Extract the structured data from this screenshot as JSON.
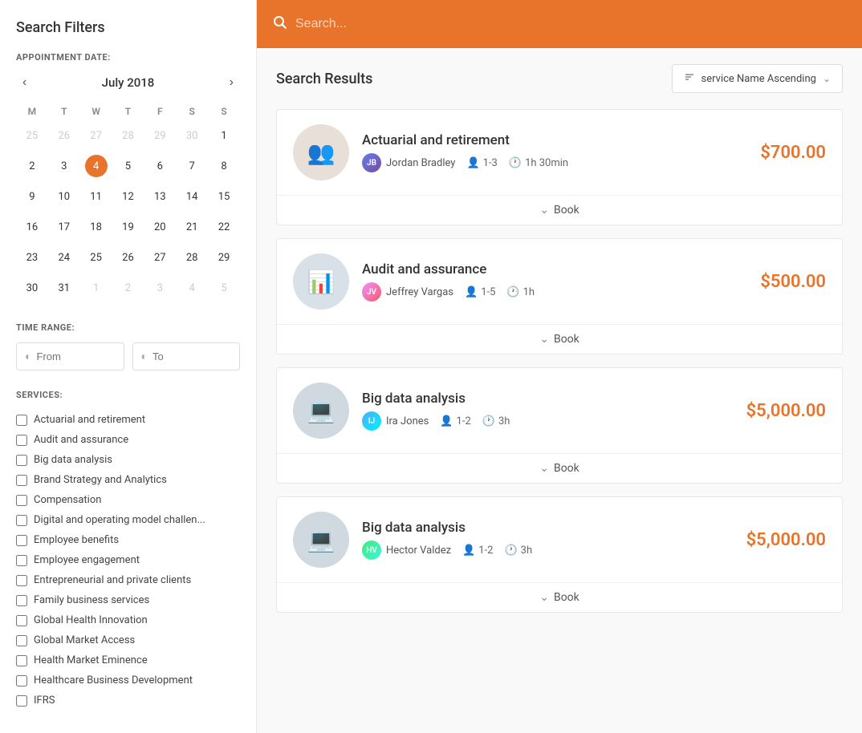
{
  "sidebar": {
    "title": "Search Filters",
    "appointment_date_label": "APPOINTMENT DATE:",
    "calendar": {
      "month_year": "July 2018",
      "days_of_week": [
        "M",
        "T",
        "W",
        "T",
        "F",
        "S",
        "S"
      ],
      "weeks": [
        [
          {
            "day": 25,
            "other": true
          },
          {
            "day": 26,
            "other": true
          },
          {
            "day": 27,
            "other": true
          },
          {
            "day": 28,
            "other": true
          },
          {
            "day": 29,
            "other": true
          },
          {
            "day": 30,
            "other": true
          },
          {
            "day": 1,
            "other": false
          }
        ],
        [
          {
            "day": 2,
            "other": false
          },
          {
            "day": 3,
            "other": false
          },
          {
            "day": 4,
            "other": false,
            "active": true
          },
          {
            "day": 5,
            "other": false
          },
          {
            "day": 6,
            "other": false
          },
          {
            "day": 7,
            "other": false
          },
          {
            "day": 8,
            "other": false
          }
        ],
        [
          {
            "day": 9,
            "other": false
          },
          {
            "day": 10,
            "other": false
          },
          {
            "day": 11,
            "other": false
          },
          {
            "day": 12,
            "other": false
          },
          {
            "day": 13,
            "other": false
          },
          {
            "day": 14,
            "other": false
          },
          {
            "day": 15,
            "other": false
          }
        ],
        [
          {
            "day": 16,
            "other": false
          },
          {
            "day": 17,
            "other": false
          },
          {
            "day": 18,
            "other": false
          },
          {
            "day": 19,
            "other": false
          },
          {
            "day": 20,
            "other": false
          },
          {
            "day": 21,
            "other": false
          },
          {
            "day": 22,
            "other": false
          }
        ],
        [
          {
            "day": 23,
            "other": false
          },
          {
            "day": 24,
            "other": false
          },
          {
            "day": 25,
            "other": false
          },
          {
            "day": 26,
            "other": false
          },
          {
            "day": 27,
            "other": false
          },
          {
            "day": 28,
            "other": false
          },
          {
            "day": 29,
            "other": false
          }
        ],
        [
          {
            "day": 30,
            "other": false
          },
          {
            "day": 31,
            "other": false
          },
          {
            "day": 1,
            "other": true
          },
          {
            "day": 2,
            "other": true
          },
          {
            "day": 3,
            "other": true
          },
          {
            "day": 4,
            "other": true
          },
          {
            "day": 5,
            "other": true
          }
        ]
      ]
    },
    "time_range_label": "TIME RANGE:",
    "from_placeholder": "From",
    "to_placeholder": "To",
    "services_label": "SERVICES:",
    "services": [
      "Actuarial and retirement",
      "Audit and assurance",
      "Big data analysis",
      "Brand Strategy and Analytics",
      "Compensation",
      "Digital and operating model challen...",
      "Employee benefits",
      "Employee engagement",
      "Entrepreneurial and private clients",
      "Family business services",
      "Global Health Innovation",
      "Global Market Access",
      "Health Market Eminence",
      "Healthcare Business Development",
      "IFRS"
    ]
  },
  "header": {
    "search_placeholder": "Search..."
  },
  "results": {
    "title": "Search Results",
    "sort_label": "service Name Ascending",
    "items": [
      {
        "id": 1,
        "service_name": "Actuarial and retirement",
        "provider_name": "Jordan Bradley",
        "capacity": "1-3",
        "duration": "1h 30min",
        "price": "$700.00",
        "book_label": "Book",
        "avatar_initials": "JB",
        "avatar_color": "avatar-1",
        "image_type": "meeting"
      },
      {
        "id": 2,
        "service_name": "Audit and assurance",
        "provider_name": "Jeffrey Vargas",
        "capacity": "1-5",
        "duration": "1h",
        "price": "$500.00",
        "book_label": "Book",
        "avatar_initials": "JV",
        "avatar_color": "avatar-2",
        "image_type": "office"
      },
      {
        "id": 3,
        "service_name": "Big data analysis",
        "provider_name": "Ira Jones",
        "capacity": "1-2",
        "duration": "3h",
        "price": "$5,000.00",
        "book_label": "Book",
        "avatar_initials": "IJ",
        "avatar_color": "avatar-3",
        "image_type": "data"
      },
      {
        "id": 4,
        "service_name": "Big data analysis",
        "provider_name": "Hector Valdez",
        "capacity": "1-2",
        "duration": "3h",
        "price": "$5,000.00",
        "book_label": "Book",
        "avatar_initials": "HV",
        "avatar_color": "avatar-4",
        "image_type": "data"
      }
    ]
  }
}
